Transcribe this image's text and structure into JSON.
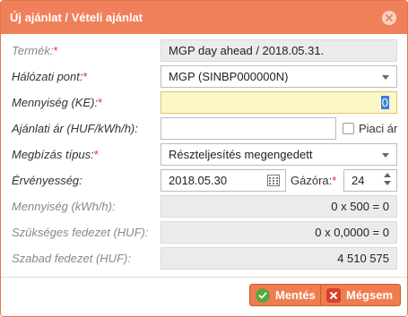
{
  "dialog": {
    "title": "Új ajánlat / Vételi ajánlat",
    "accent_color": "#f0805a"
  },
  "fields": {
    "termek": {
      "label": "Termék:",
      "required": "*",
      "value": "MGP day ahead / 2018.05.31."
    },
    "halozati_pont": {
      "label": "Hálózati pont:",
      "required": "*",
      "value": "MGP (SINBP000000N)"
    },
    "mennyiseg_ke": {
      "label": "Mennyiség (KE):",
      "required": "*",
      "value": "0"
    },
    "ajanlati_ar": {
      "label": "Ajánlati ár (HUF/kWh/h):",
      "value": "",
      "checkbox_label": "Piaci ár"
    },
    "megbizas_tipus": {
      "label": "Megbízás típus:",
      "required": "*",
      "value": "Részteljesítés megengedett"
    },
    "ervenyesseg": {
      "label": "Érvényesség:",
      "date": "2018.05.30",
      "hour_label": "Gázóra:",
      "hour_required": "*",
      "hour": "24"
    },
    "mennyiseg_kwh": {
      "label": "Mennyiség (kWh/h):",
      "value": "0 x 500 = 0"
    },
    "szukseges_fedezet": {
      "label": "Szükséges fedezet (HUF):",
      "value": "0 x 0,0000 = 0"
    },
    "szabad_fedezet": {
      "label": "Szabad fedezet (HUF):",
      "value": "4 510 575"
    }
  },
  "buttons": {
    "save_label": "Mentés",
    "cancel_label": "Mégsem"
  }
}
